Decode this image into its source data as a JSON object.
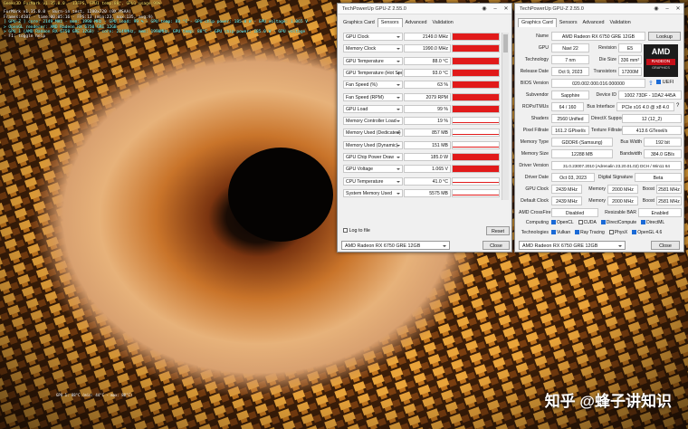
{
  "furmark": {
    "title": "Geeks3D FurMark v1.35.0.0 - 13FPS, GPU1 temp:88°, GPU1 usage:99%",
    "hud_lines": [
      "FurMark v1.35.0.0 - Burn-in test, 1280x720 (0X MSAA)",
      "Frames:4107 - time:00:05:16 - FPS:13 (min:23, max:135, avg:9)",
      "[ GPU-Z ] core: 2149 MHz - mem: 1990 MHz - GPU load: 99 % - GPU temp: 88 °C - GPU chip power: 185.0 W - GPU voltage: 1.065 V",
      "> OpenGL renderer: AMD Radeon RX 6750 GRE 12GB",
      "> GPU 1 (AMD Radeon RX 6750 GRE 12GB) - core: 2149MHz, mem: 1990MHz, GPU temp: 88°C - GPU chip power: 185.0 W - GPU voltage",
      "- F1: toggle help"
    ],
    "bottom_text": "GPU 1: 88°C (min: 44°C - max: 88°C)"
  },
  "sensors_window": {
    "title": "TechPowerUp GPU-Z 2.55.0",
    "tabs": [
      "Graphics Card",
      "Sensors",
      "Advanced",
      "Validation"
    ],
    "active_tab": "Sensors",
    "rows": [
      {
        "name": "GPU Clock",
        "value": "2149.0 MHz",
        "level": 1.0
      },
      {
        "name": "Memory Clock",
        "value": "1990.0 MHz",
        "level": 1.0
      },
      {
        "name": "GPU Temperature",
        "value": "88.0 °C",
        "level": 1.0
      },
      {
        "name": "GPU Temperature (Hot Spot)",
        "value": "93.0 °C",
        "level": 1.0
      },
      {
        "name": "Fan Speed (%)",
        "value": "63 %",
        "level": 1.0
      },
      {
        "name": "Fan Speed (RPM)",
        "value": "2079 RPM",
        "level": 1.0
      },
      {
        "name": "GPU Load",
        "value": "99 %",
        "level": 1.0
      },
      {
        "name": "Memory Controller Load",
        "value": "19 %",
        "level": 0.12
      },
      {
        "name": "Memory Used (Dedicated)",
        "value": "857 MB",
        "level": 0.07
      },
      {
        "name": "Memory Used (Dynamic)",
        "value": "151 MB",
        "level": 0.02
      },
      {
        "name": "GPU Chip Power Draw",
        "value": "185.0 W",
        "level": 1.0
      },
      {
        "name": "GPU Voltage",
        "value": "1.065 V",
        "level": 1.0
      },
      {
        "name": "CPU Temperature",
        "value": "41.0 °C",
        "level": 0.2
      },
      {
        "name": "System Memory Used",
        "value": "5575 MB",
        "level": 0.12
      }
    ],
    "log_label": "Log to file",
    "reset_label": "Reset",
    "gpu_select": "AMD Radeon RX 6750 GRE 12GB",
    "close_label": "Close"
  },
  "card_window": {
    "title": "TechPowerUp GPU-Z 2.55.0",
    "tabs": [
      "Graphics Card",
      "Sensors",
      "Advanced",
      "Validation"
    ],
    "active_tab": "Graphics Card",
    "name_label": "Name",
    "name_value": "AMD Radeon RX 6750 GRE 12GB",
    "lookup_label": "Lookup",
    "gpu_label": "GPU",
    "gpu_value": "Navi 22",
    "revision_label": "Revision",
    "revision_value": "E5",
    "technology_label": "Technology",
    "technology_value": "7 nm",
    "die_size_label": "Die Size",
    "die_size_value": "336 mm²",
    "release_label": "Release Date",
    "release_value": "Oct 9, 2023",
    "transistors_label": "Transistors",
    "transistors_value": "17200M",
    "bios_label": "BIOS Version",
    "bios_value": "020.002.000.016.000000",
    "uefi_label": "UEFI",
    "subvendor_label": "Subvendor",
    "subvendor_value": "Sapphire",
    "device_id_label": "Device ID",
    "device_id_value": "1002 73DF - 1DA2 445A",
    "rops_label": "ROPs/TMUs",
    "rops_value": "64 / 160",
    "bus_label": "Bus Interface",
    "bus_value": "PCIe x16 4.0 @ x8 4.0",
    "shaders_label": "Shaders",
    "shaders_value": "2560 Unified",
    "dx_label": "DirectX Support",
    "dx_value": "12 (12_2)",
    "pixel_label": "Pixel Fillrate",
    "pixel_value": "161.2 GPixel/s",
    "texture_label": "Texture Fillrate",
    "texture_value": "413.6 GTexel/s",
    "memtype_label": "Memory Type",
    "memtype_value": "GDDR6 (Samsung)",
    "buswidth_label": "Bus Width",
    "buswidth_value": "192 bit",
    "memsize_label": "Memory Size",
    "memsize_value": "12288 MB",
    "bandwidth_label": "Bandwidth",
    "bandwidth_value": "384.0 GB/s",
    "driver_label": "Driver Version",
    "driver_value": "31.0.23007.2010 (Adrenalin 23.20.01.02) DCH / Win11 64",
    "driverdate_label": "Driver Date",
    "driverdate_value": "Oct 03, 2023",
    "signature_label": "Digital Signature",
    "signature_value": "Beta",
    "gpuclock_label": "GPU Clock",
    "gpuclock_value": "2439 MHz",
    "memory_label": "Memory",
    "memory_value": "2000 MHz",
    "boost_label": "Boost",
    "boost_value": "2581 MHz",
    "defclock_label": "Default Clock",
    "defclock_value": "2439 MHz",
    "memory2_value": "2000 MHz",
    "boost2_value": "2581 MHz",
    "crossfire_label": "AMD CrossFire",
    "crossfire_value": "Disabled",
    "rebar_label": "Resizable BAR",
    "rebar_value": "Enabled",
    "computing_label": "Computing",
    "computing": [
      {
        "label": "OpenCL",
        "checked": true
      },
      {
        "label": "CUDA",
        "checked": false
      },
      {
        "label": "DirectCompute",
        "checked": true
      },
      {
        "label": "DirectML",
        "checked": true
      }
    ],
    "technologies_label": "Technologies",
    "technologies": [
      {
        "label": "Vulkan",
        "checked": true
      },
      {
        "label": "Ray Tracing",
        "checked": true
      },
      {
        "label": "PhysX",
        "checked": false
      },
      {
        "label": "OpenGL 4.6",
        "checked": true
      }
    ],
    "gpu_select": "AMD Radeon RX 6750 GRE 12GB",
    "close_label": "Close",
    "logo_text": "AMD",
    "logo_sub": "RADEON",
    "logo_sub2": "GRAPHICS"
  },
  "watermark": "知乎 @蜂子讲知识",
  "colors": {
    "graph_red": "#e11a1a",
    "amd_logo_bg": "#1b1b1b",
    "amd_red": "#c40f18"
  }
}
